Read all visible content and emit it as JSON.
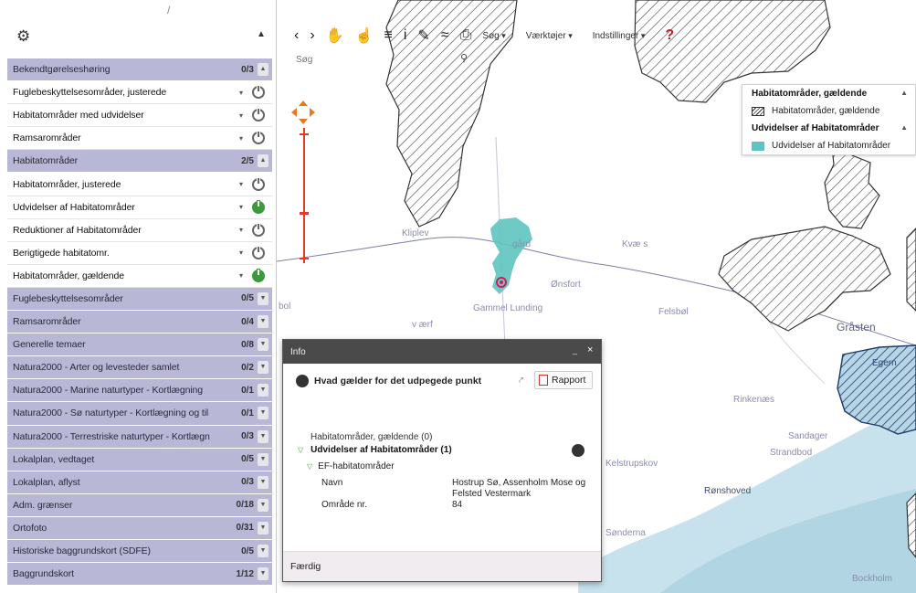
{
  "left_panel": {
    "layers": [
      {
        "label": "Bekendtgørelseshøring",
        "type": "group",
        "count": "0/3",
        "ctrl": "▲"
      },
      {
        "label": "Fuglebeskyttelsesområder, justerede",
        "type": "item",
        "on": false
      },
      {
        "label": "Habitatområder med udvidelser",
        "type": "item",
        "on": false
      },
      {
        "label": "Ramsarområder",
        "type": "item",
        "on": false
      },
      {
        "label": "Habitatområder",
        "type": "group",
        "count": "2/5",
        "ctrl": "▲"
      },
      {
        "label": "Habitatområder, justerede",
        "type": "item",
        "on": false
      },
      {
        "label": "Udvidelser af Habitatområder",
        "type": "item",
        "on": true
      },
      {
        "label": "Reduktioner af Habitatområder",
        "type": "item",
        "on": false
      },
      {
        "label": "Berigtigede habitatomr.",
        "type": "item",
        "on": false
      },
      {
        "label": "Habitatområder, gældende",
        "type": "item",
        "on": true
      },
      {
        "label": "Fuglebeskyttelsesområder",
        "type": "group",
        "count": "0/5",
        "ctrl": "▼"
      },
      {
        "label": "Ramsarområder",
        "type": "group",
        "count": "0/4",
        "ctrl": "▼"
      },
      {
        "label": "Generelle temaer",
        "type": "group",
        "count": "0/8",
        "ctrl": "▼"
      },
      {
        "label": "Natura2000 - Arter og levesteder samlet",
        "type": "group",
        "count": "0/2",
        "ctrl": "▼"
      },
      {
        "label": "Natura2000 - Marine naturtyper - Kortlægning",
        "type": "group",
        "count": "0/1",
        "ctrl": "▼"
      },
      {
        "label": "Natura2000 - Sø naturtyper - Kortlægning og til",
        "type": "group",
        "count": "0/1",
        "ctrl": "▼"
      },
      {
        "label": "Natura2000 - Terrestriske naturtyper - Kortlægn",
        "type": "group",
        "count": "0/3",
        "ctrl": "▼"
      },
      {
        "label": "Lokalplan, vedtaget",
        "type": "group",
        "count": "0/5",
        "ctrl": "▼"
      },
      {
        "label": "Lokalplan, aflyst",
        "type": "group",
        "count": "0/3",
        "ctrl": "▼"
      },
      {
        "label": "Adm. grænser",
        "type": "group",
        "count": "0/18",
        "ctrl": "▼"
      },
      {
        "label": "Ortofoto",
        "type": "group",
        "count": "0/31",
        "ctrl": "▼"
      },
      {
        "label": "Historiske baggrundskort (SDFE)",
        "type": "group",
        "count": "0/5",
        "ctrl": "▼"
      },
      {
        "label": "Baggrundskort",
        "type": "group",
        "count": "1/12",
        "ctrl": "▼"
      }
    ]
  },
  "toolbar": {
    "icons": {
      "back": "‹",
      "forward": "›",
      "pan": "✋",
      "info_hand": "☝",
      "list": "≡",
      "info": "i",
      "measure": "✎",
      "share": "≈",
      "print": "⎙",
      "help": "?"
    },
    "menu_search": "Søg",
    "menu_tools": "Værktøjer",
    "menu_settings": "Indstillinger",
    "search_placeholder": "Søg",
    "search_glyph": "⚲"
  },
  "legend": {
    "group1_title": "Habitatområder, gældende",
    "group1_item": "Habitatområder, gældende",
    "group2_title": "Udvidelser af Habitatområder",
    "group2_item": "Udvidelser af Habitatområder",
    "collapse_glyph": "▲"
  },
  "map_labels": {
    "kliplev": "Kliplev",
    "gaard": "gård",
    "kvaers": "Kvæ s",
    "gammel_lunding": "Gammel Lunding",
    "bol": "bol",
    "vaerft": "v ærf",
    "gasten": "Gråsten",
    "egernsund": "Egern",
    "rinkenaes": "Rinkenæs",
    "strandbod": "Strandbod",
    "kelstrupskov": "Kelstrupskov",
    "ronshoved": "Rønshoved",
    "sandager": "Sandager",
    "bockholm": "Bockholm",
    "sondernaes": "Sønderna",
    "felsbol": "Felsbøl",
    "tumbrofft": "Ønsfort"
  },
  "info": {
    "title": "Info",
    "min_glyph": "_",
    "close_glyph": "×",
    "question": "Hvad gælder for det udpegede punkt",
    "share_glyph": "⤤",
    "report_label": "Rapport",
    "section1": "Habitatområder, gældende (0)",
    "section2": "Udvidelser af Habitatområder (1)",
    "subsection": "EF-habitatområder",
    "rows": [
      {
        "key": "Navn",
        "value": "Hostrup Sø, Assenholm Mose og Felsted Vestermark"
      },
      {
        "key": "Område nr.",
        "value": "84"
      }
    ],
    "footer": "Færdig"
  },
  "colors": {
    "group_bg": "#b9b7d6",
    "highlight_teal": "#5fc4c0",
    "power_on": "#3c9a3c",
    "water": "#b4d8e6"
  }
}
